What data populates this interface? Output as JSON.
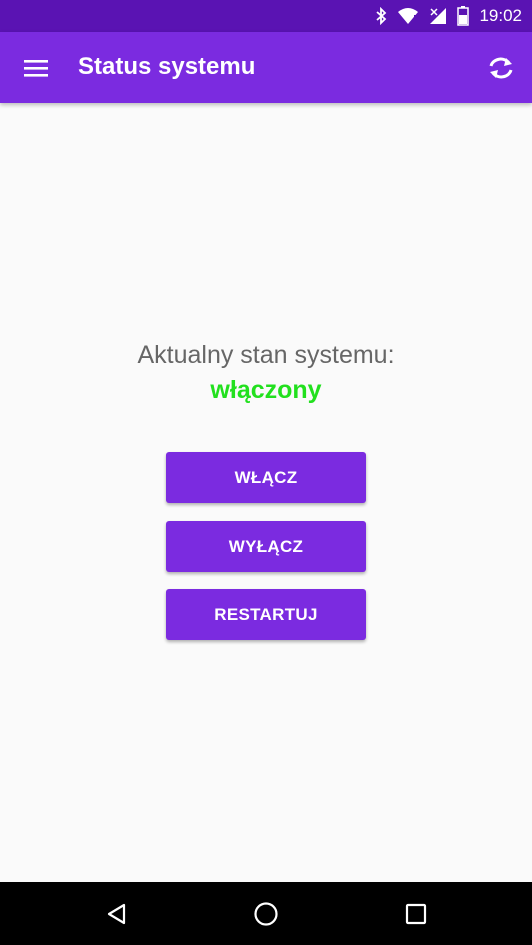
{
  "status_bar": {
    "time": "19:02",
    "icons": [
      "bluetooth-icon",
      "wifi-icon",
      "signal-icon",
      "battery-icon"
    ]
  },
  "app_bar": {
    "title": "Status systemu",
    "menu_icon": "menu-icon",
    "refresh_icon": "refresh-icon"
  },
  "main": {
    "state_label": "Aktualny stan systemu:",
    "state_value": "włączony",
    "state_color": "#22e01e",
    "buttons": {
      "on": "WŁĄCZ",
      "off": "WYŁĄCZ",
      "restart": "RESTARTUJ"
    }
  },
  "nav_bar": {
    "icons": [
      "back-icon",
      "home-icon",
      "recent-apps-icon"
    ]
  },
  "colors": {
    "primary": "#7b2be0",
    "primary_dark": "#5a13b3",
    "background": "#fafafa"
  }
}
